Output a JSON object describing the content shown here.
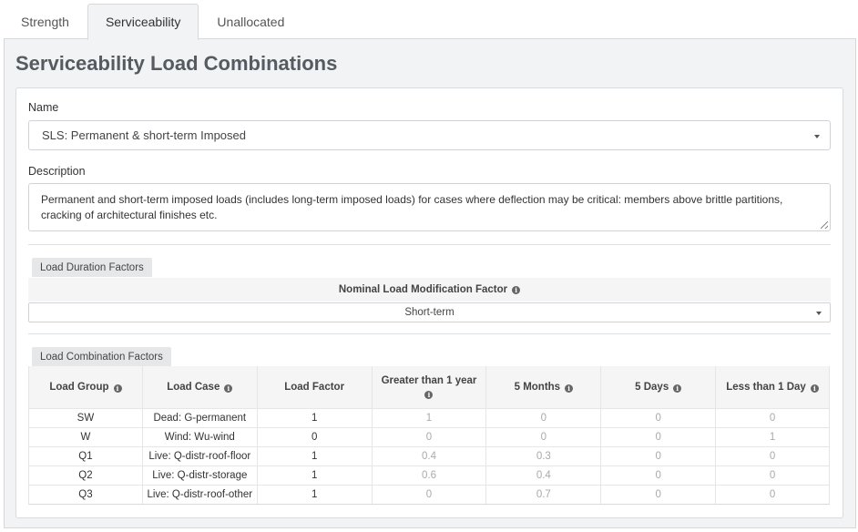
{
  "tabs": [
    {
      "label": "Strength"
    },
    {
      "label": "Serviceability"
    },
    {
      "label": "Unallocated"
    }
  ],
  "panel_title": "Serviceability Load Combinations",
  "name_field": {
    "label": "Name",
    "value": "SLS: Permanent & short-term Imposed"
  },
  "description_field": {
    "label": "Description",
    "value": "Permanent and short-term imposed loads (includes long-term imposed loads) for cases where deflection may be critical: members above brittle partitions, cracking of architectural finishes etc."
  },
  "duration_section": {
    "label": "Load Duration Factors",
    "header": "Nominal Load Modification Factor",
    "selected": "Short-term"
  },
  "combination_section": {
    "label": "Load Combination Factors",
    "columns": [
      "Load Group",
      "Load Case",
      "Load Factor",
      "Greater than 1 year",
      "5 Months",
      "5 Days",
      "Less than 1 Day"
    ],
    "rows": [
      [
        "SW",
        "Dead: G-permanent",
        "1",
        "1",
        "0",
        "0",
        "0"
      ],
      [
        "W",
        "Wind: Wu-wind",
        "0",
        "0",
        "0",
        "0",
        "1"
      ],
      [
        "Q1",
        "Live: Q-distr-roof-floor",
        "1",
        "0.4",
        "0.3",
        "0",
        "0"
      ],
      [
        "Q2",
        "Live: Q-distr-storage",
        "1",
        "0.6",
        "0.4",
        "0",
        "0"
      ],
      [
        "Q3",
        "Live: Q-distr-roof-other",
        "1",
        "0",
        "0.7",
        "0",
        "0"
      ]
    ]
  },
  "icons": {
    "info": "info-circle-icon",
    "caret": "caret-down-icon",
    "resize": "resize-grip-icon"
  },
  "colors": {
    "panel_bg": "#f2f3f4",
    "title": "#555b61",
    "muted_value": "#aaaaaa"
  }
}
